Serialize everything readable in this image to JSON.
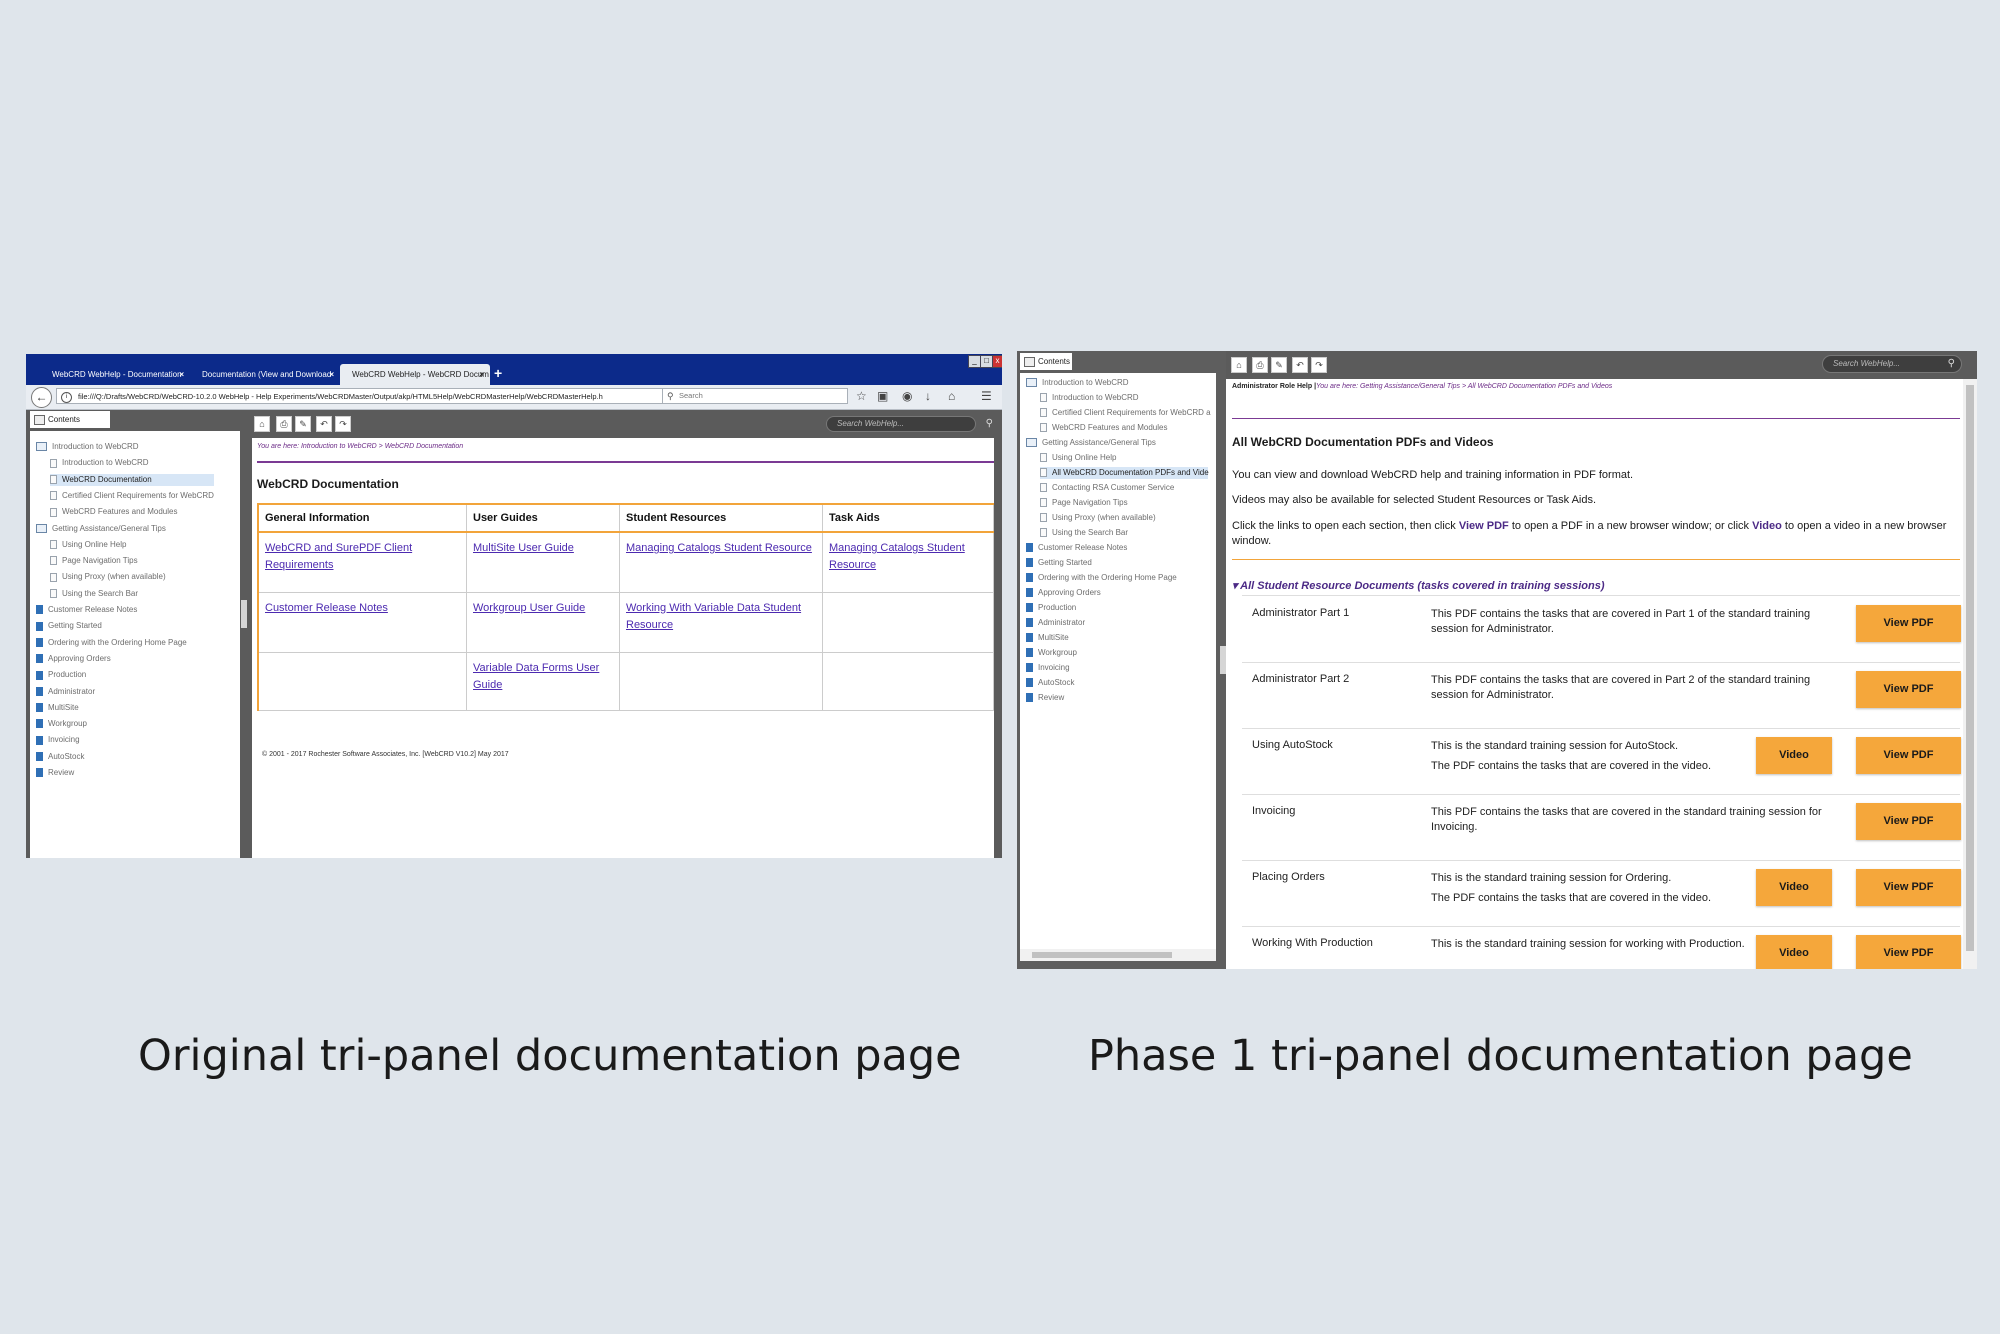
{
  "captions": {
    "left": "Original tri-panel documentation page",
    "right": "Phase 1 tri-panel documentation page"
  },
  "icons": {
    "back": "arrow-left-icon",
    "info": "info-icon",
    "reload": "reload-icon",
    "search": "search-icon",
    "star": "star-icon",
    "home": "home-icon",
    "print": "print-icon",
    "pdf": "pdf-icon",
    "previous": "undo-arrow-icon",
    "next": "redo-arrow-icon",
    "book": "book-icon",
    "page": "page-icon"
  },
  "colors": {
    "background": "#dfe5eb",
    "browser_tabbar": "#0c2a8a",
    "accent_purple": "#6b2a86",
    "accent_orange": "#f5a73b",
    "link": "#4c2ab0"
  },
  "left": {
    "tabs": [
      {
        "label": "WebCRD WebHelp - Documentation",
        "close": "×"
      },
      {
        "label": "Documentation (View and Download",
        "close": "×"
      },
      {
        "label": "WebCRD WebHelp - WebCRD Docum",
        "close": "×"
      }
    ],
    "new_tab": "+",
    "url": "file:///Q:/Drafts/WebCRD/WebCRD-10.2.0 WebHelp - Help Experiments/WebCRDMaster/Output/akp/HTML5Help/WebCRDMasterHelp/WebCRDMasterHelp.h",
    "browser_search_placeholder": "Search",
    "contents_tab": "Contents",
    "webhelp_search_placeholder": "Search WebHelp...",
    "toc": [
      {
        "label": "Introduction to WebCRD",
        "type": "book-open",
        "level": 0
      },
      {
        "label": "Introduction to WebCRD",
        "type": "page",
        "level": 1
      },
      {
        "label": "WebCRD Documentation",
        "type": "page",
        "level": 1,
        "selected": true
      },
      {
        "label": "Certified Client Requirements for WebCRD",
        "type": "page",
        "level": 1
      },
      {
        "label": "WebCRD Features and Modules",
        "type": "page",
        "level": 1
      },
      {
        "label": "Getting Assistance/General Tips",
        "type": "book-open",
        "level": 0
      },
      {
        "label": "Using Online Help",
        "type": "page",
        "level": 1
      },
      {
        "label": "Page Navigation Tips",
        "type": "page",
        "level": 1
      },
      {
        "label": "Using Proxy (when available)",
        "type": "page",
        "level": 1
      },
      {
        "label": "Using the Search Bar",
        "type": "page",
        "level": 1
      },
      {
        "label": "Customer Release Notes",
        "type": "book",
        "level": 0
      },
      {
        "label": "Getting Started",
        "type": "book",
        "level": 0
      },
      {
        "label": "Ordering with the Ordering Home Page",
        "type": "book",
        "level": 0
      },
      {
        "label": "Approving Orders",
        "type": "book",
        "level": 0
      },
      {
        "label": "Production",
        "type": "book",
        "level": 0
      },
      {
        "label": "Administrator",
        "type": "book",
        "level": 0
      },
      {
        "label": "MultiSite",
        "type": "book",
        "level": 0
      },
      {
        "label": "Workgroup",
        "type": "book",
        "level": 0
      },
      {
        "label": "Invoicing",
        "type": "book",
        "level": 0
      },
      {
        "label": "AutoStock",
        "type": "book",
        "level": 0
      },
      {
        "label": "Review",
        "type": "book",
        "level": 0
      }
    ],
    "breadcrumb": "You are here: Introduction to WebCRD > WebCRD Documentation",
    "title": "WebCRD Documentation",
    "table": {
      "headers": [
        "General Information",
        "User Guides",
        "Student Resources",
        "Task Aids"
      ],
      "rows": [
        [
          "WebCRD and SurePDF Client Requirements",
          "MultiSite User Guide",
          "Managing Catalogs Student Resource",
          "Managing Catalogs Student Resource"
        ],
        [
          "Customer Release Notes",
          "Workgroup User Guide",
          "Working With Variable Data Student Resource",
          ""
        ],
        [
          "",
          "Variable Data Forms User Guide",
          "",
          ""
        ]
      ]
    },
    "copyright": "© 2001 - 2017 Rochester Software Associates, Inc. [WebCRD V10.2] May 2017"
  },
  "right": {
    "contents_tab": "Contents",
    "webhelp_search_placeholder": "Search WebHelp...",
    "toc": [
      {
        "label": "Introduction to WebCRD",
        "type": "book-open",
        "level": 0
      },
      {
        "label": "Introduction to WebCRD",
        "type": "page",
        "level": 1
      },
      {
        "label": "Certified Client Requirements for WebCRD a",
        "type": "page",
        "level": 1
      },
      {
        "label": "WebCRD Features and Modules",
        "type": "page",
        "level": 1
      },
      {
        "label": "Getting Assistance/General Tips",
        "type": "book-open",
        "level": 0
      },
      {
        "label": "Using Online Help",
        "type": "page",
        "level": 1
      },
      {
        "label": "All WebCRD Documentation PDFs and Vide",
        "type": "page",
        "level": 1,
        "selected": true
      },
      {
        "label": "Contacting RSA Customer Service",
        "type": "page",
        "level": 1
      },
      {
        "label": "Page Navigation Tips",
        "type": "page",
        "level": 1
      },
      {
        "label": "Using Proxy (when available)",
        "type": "page",
        "level": 1
      },
      {
        "label": "Using the Search Bar",
        "type": "page",
        "level": 1
      },
      {
        "label": "Customer Release Notes",
        "type": "book",
        "level": 0
      },
      {
        "label": "Getting Started",
        "type": "book",
        "level": 0
      },
      {
        "label": "Ordering with the Ordering Home Page",
        "type": "book",
        "level": 0
      },
      {
        "label": "Approving Orders",
        "type": "book",
        "level": 0
      },
      {
        "label": "Production",
        "type": "book",
        "level": 0
      },
      {
        "label": "Administrator",
        "type": "book",
        "level": 0
      },
      {
        "label": "MultiSite",
        "type": "book",
        "level": 0
      },
      {
        "label": "Workgroup",
        "type": "book",
        "level": 0
      },
      {
        "label": "Invoicing",
        "type": "book",
        "level": 0
      },
      {
        "label": "AutoStock",
        "type": "book",
        "level": 0
      },
      {
        "label": "Review",
        "type": "book",
        "level": 0
      }
    ],
    "role": "Administrator Role Help |",
    "breadcrumb": "You are here: Getting Assistance/General Tips > All WebCRD Documentation PDFs and Videos",
    "title": "All WebCRD Documentation PDFs and Videos",
    "intro1": "You can view and download WebCRD help and training information in PDF format.",
    "intro2": "Videos may also be available for selected Student Resources or Task Aids.",
    "intro3_a": "Click the links to open each section, then click ",
    "intro3_b": "View PDF",
    "intro3_c": " to open a PDF in a new browser window; or click ",
    "intro3_d": "Video",
    "intro3_e": " to open a video in a new browser window.",
    "section": "▾ All Student Resource Documents (tasks covered in training sessions)",
    "video_label": "Video",
    "pdf_label": "View PDF",
    "rows": [
      {
        "name": "Administrator Part 1",
        "d1": "This PDF contains the tasks that are covered in Part 1 of the standard training session for Administrator.",
        "d2": "",
        "video": false
      },
      {
        "name": "Administrator Part 2",
        "d1": "This PDF contains the tasks that are covered in Part 2 of the standard training session for Administrator.",
        "d2": "",
        "video": false
      },
      {
        "name": "Using AutoStock",
        "d1": "This is the standard training session for AutoStock.",
        "d2": "The PDF contains the tasks that are covered in the video.",
        "video": true
      },
      {
        "name": "Invoicing",
        "d1": "This PDF contains the tasks that are covered in the standard training session for Invoicing.",
        "d2": "",
        "video": false
      },
      {
        "name": "Placing Orders",
        "d1": "This is the standard training session for Ordering.",
        "d2": "The PDF contains the tasks that are covered in the video.",
        "video": true
      },
      {
        "name": "Working With Production",
        "d1": "This is the standard training session for working with Production.",
        "d2": "",
        "video": true
      }
    ]
  }
}
